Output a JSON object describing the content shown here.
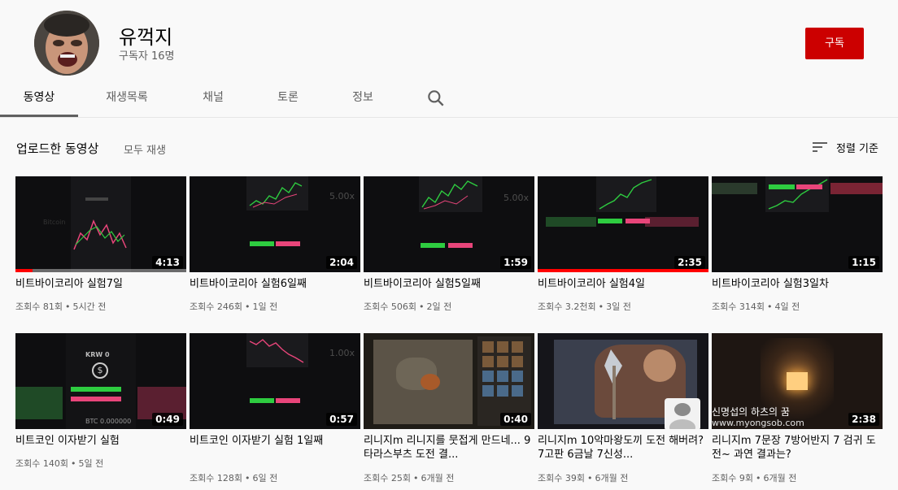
{
  "channel": {
    "name": "유꺽지",
    "subscribers": "구독자 16명",
    "subscribe_label": "구독"
  },
  "tabs": [
    {
      "label": "동영상",
      "active": true
    },
    {
      "label": "재생목록"
    },
    {
      "label": "채널"
    },
    {
      "label": "토론"
    },
    {
      "label": "정보"
    }
  ],
  "section": {
    "title": "업로드한 동영상",
    "play_all": "모두 재생",
    "sort_label": "정렬 기준"
  },
  "videos": [
    {
      "title": "비트바이코리아 실험7일",
      "views": "조회수 81회",
      "age": "5시간 전",
      "duration": "4:13",
      "watched": 0.1
    },
    {
      "title": "비트바이코리아 실험6일째",
      "views": "조회수 246회",
      "age": "1일 전",
      "duration": "2:04"
    },
    {
      "title": "비트바이코리아 실험5일째",
      "views": "조회수 506회",
      "age": "2일 전",
      "duration": "1:59"
    },
    {
      "title": "비트바이코리아 실험4일",
      "views": "조회수 3.2천회",
      "age": "3일 전",
      "duration": "2:35",
      "watched": 1.0
    },
    {
      "title": "비트바이코리아 실험3일차",
      "views": "조회수 314회",
      "age": "4일 전",
      "duration": "1:15"
    },
    {
      "title": "비트코인 이자받기 실험",
      "views": "조회수 140회",
      "age": "5일 전",
      "duration": "0:49"
    },
    {
      "title": "비트코인 이자받기 실험 1일째",
      "views": "조회수 128회",
      "age": "6일 전",
      "duration": "0:57"
    },
    {
      "title": "리니지m 리니지를 뭇접게 만드네... 9타라스부츠 도전 결...",
      "views": "조회수 25회",
      "age": "6개월 전",
      "duration": "0:40"
    },
    {
      "title": "리니지m 10악마왕도끼 도전 해버려? 7고판 6금날 7신성...",
      "views": "조회수 39회",
      "age": "6개월 전",
      "duration": ""
    },
    {
      "title": "리니지m 7문장 7방어반지 7 검귀 도전~ 과연 결과는?",
      "views": "조회수 9회",
      "age": "6개월 전",
      "duration": "2:38"
    }
  ],
  "thumb_text": {
    "t2_ratio": "5.00x",
    "t3_ratio": "5.00x",
    "t7_ratio": "1.00x",
    "t6_currency": "KRW 0",
    "t6_btc": "BTC 0.000000",
    "t10_overlay": "신명섭의 하츠의 꿈",
    "t10_url": "www.myongsob.com"
  },
  "colors": {
    "accent": "#cc0000",
    "progress": "#ff0000",
    "buy": "#2ecc40",
    "sell": "#e8457a"
  }
}
